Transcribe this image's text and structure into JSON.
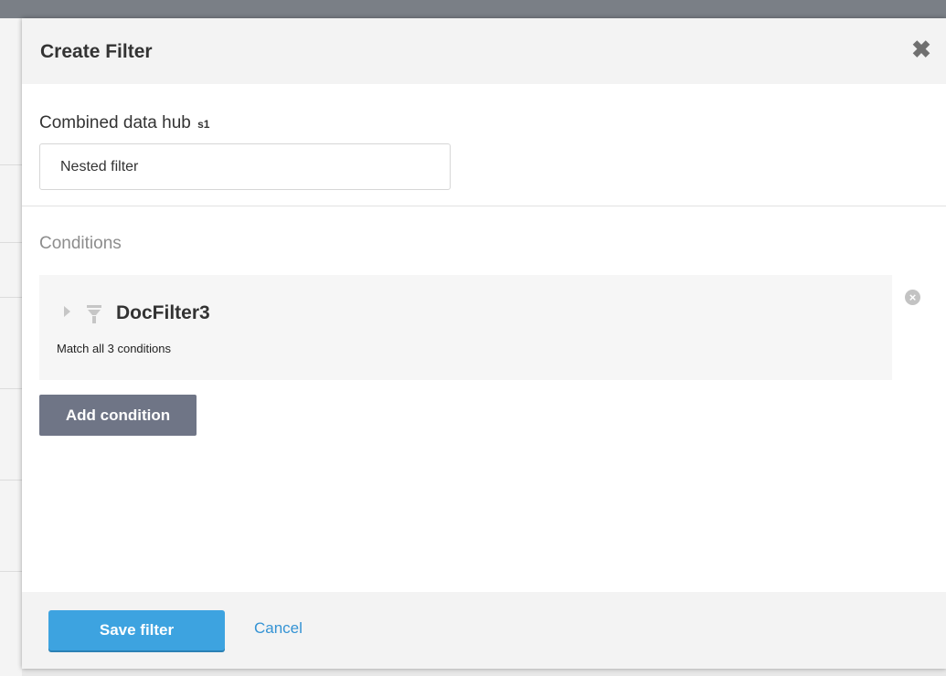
{
  "dialog": {
    "title": "Create Filter",
    "close_icon": "close-icon"
  },
  "name_field": {
    "label": "Combined data hub",
    "label_suffix": "s1",
    "value": "Nested filter"
  },
  "conditions": {
    "section_label": "Conditions",
    "items": [
      {
        "name": "DocFilter3",
        "summary": "Match all 3 conditions",
        "icons": [
          "expand-arrow-icon",
          "filter-funnel-icon",
          "remove-circle-icon"
        ]
      }
    ],
    "add_label": "Add condition"
  },
  "footer": {
    "save_label": "Save filter",
    "cancel_label": "Cancel"
  },
  "colors": {
    "primary_button": "#3da3e0",
    "secondary_button": "#6f7586",
    "link": "#3493d4",
    "header_background": "#f3f3f3"
  }
}
